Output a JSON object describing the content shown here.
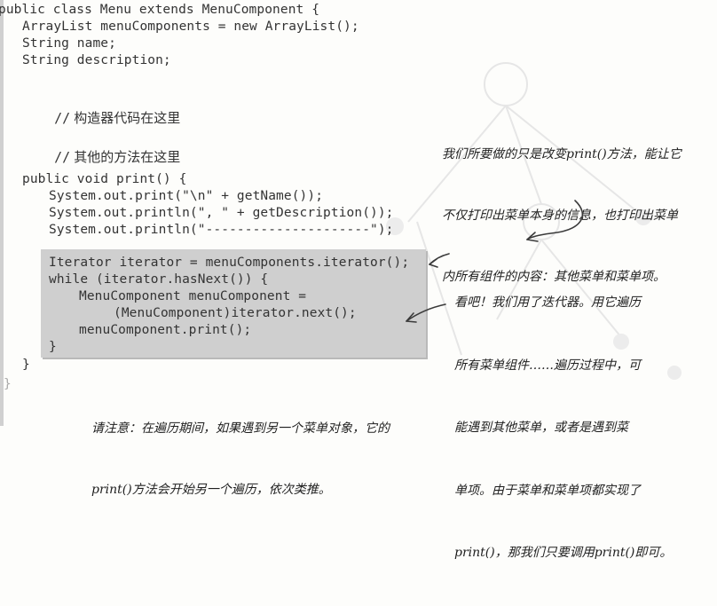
{
  "code": {
    "class_header": "public class Menu extends MenuComponent {",
    "fields": [
      "ArrayList menuComponents = new ArrayList();",
      "String name;",
      "String description;"
    ],
    "method_signature": "public void print() {",
    "print_lines": [
      "System.out.print(\"\\n\" + getName());",
      "System.out.println(\", \" + getDescription());",
      "System.out.println(\"---------------------\");"
    ],
    "iterator_lines": [
      "Iterator iterator = menuComponents.iterator();",
      "while (iterator.hasNext()) {",
      "MenuComponent menuComponent =",
      "(MenuComponent)iterator.next();",
      "menuComponent.print();",
      "}"
    ],
    "method_close": "}",
    "class_close": "}"
  },
  "comments": {
    "constructor": {
      "slashes": "//",
      "text": "构造器代码在这里"
    },
    "other_methods": {
      "slashes": "//",
      "text": "其他的方法在这里"
    }
  },
  "notes": {
    "top_right": [
      "我们所要做的只是改变print()方法，能让它",
      "不仅打印出菜单本身的信息，也打印出菜单",
      "内所有组件的内容：其他菜单和菜单项。"
    ],
    "middle_right": [
      "看吧！我们用了迭代器。用它遍历",
      "所有菜单组件……遍历过程中，可",
      "能遇到其他菜单，或者是遇到菜",
      "单项。由于菜单和菜单项都实现了",
      "print()，那我们只要调用print()即可。"
    ],
    "bottom": [
      "请注意：在遍历期间，如果遇到另一个菜单对象，它的",
      "print()方法会开始另一个遍历，依次类推。"
    ]
  },
  "colors": {
    "highlight": "#cfcfcf",
    "ink": "#2b2b2b"
  }
}
